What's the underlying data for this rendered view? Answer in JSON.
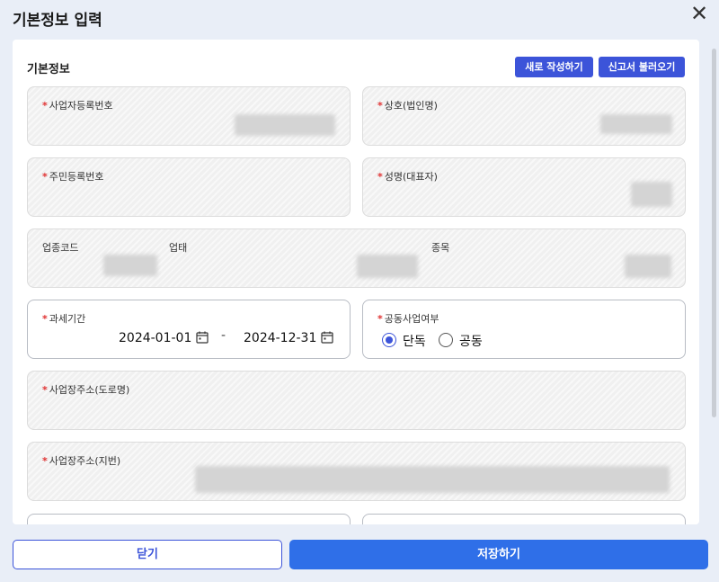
{
  "modal": {
    "title": "기본정보 입력",
    "close_icon": "close-icon"
  },
  "section": {
    "title": "기본정보",
    "new_button": "새로 작성하기",
    "load_button": "신고서 불러오기"
  },
  "fields": {
    "business_reg_no": {
      "required": "*",
      "label": "사업자등록번호"
    },
    "company_name": {
      "required": "*",
      "label": "상호(법인명)"
    },
    "resident_reg_no": {
      "required": "*",
      "label": "주민등록번호"
    },
    "representative": {
      "required": "*",
      "label": "성명(대표자)"
    },
    "industry_code": {
      "label": "업종코드"
    },
    "business_type": {
      "label": "업태"
    },
    "business_item": {
      "label": "종목"
    },
    "tax_period": {
      "required": "*",
      "label": "과세기간",
      "start": "2024-01-01",
      "separator": "-",
      "end": "2024-12-31"
    },
    "joint_business": {
      "required": "*",
      "label": "공동사업여부",
      "options": [
        "단독",
        "공동"
      ],
      "selected": "단독"
    },
    "address_road": {
      "required": "*",
      "label": "사업장주소(도로명)"
    },
    "address_lot": {
      "required": "*",
      "label": "사업장주소(지번)"
    }
  },
  "footer": {
    "close_label": "닫기",
    "save_label": "저장하기"
  },
  "colors": {
    "accent": "#3c54d9",
    "save": "#2f6fe8",
    "required": "#e03131",
    "background": "#e9eef7"
  }
}
